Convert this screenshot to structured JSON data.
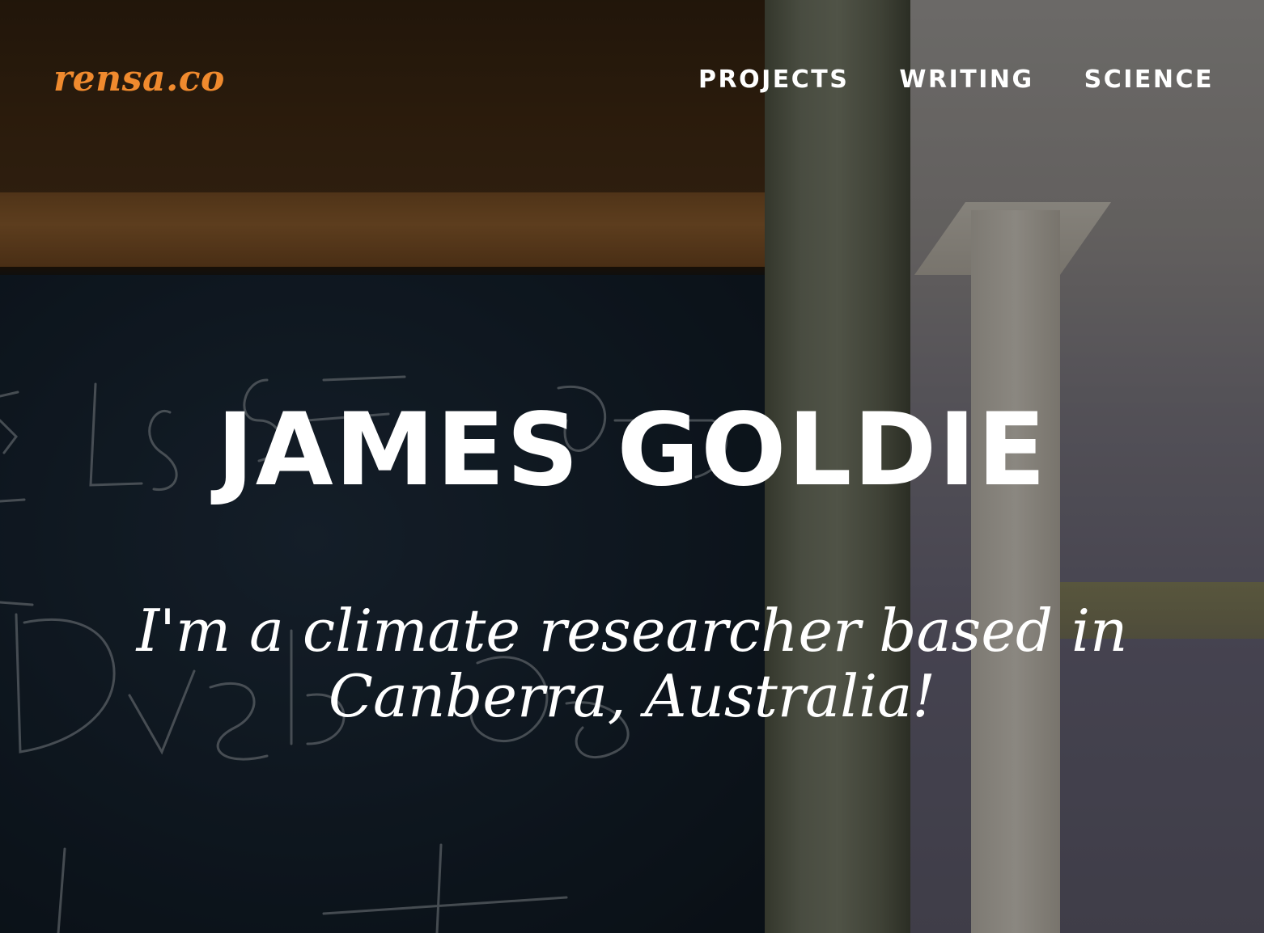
{
  "header": {
    "logo": "rensa.co",
    "nav": [
      {
        "label": "PROJECTS"
      },
      {
        "label": "WRITING"
      },
      {
        "label": "SCIENCE"
      }
    ]
  },
  "hero": {
    "title": "JAMES GOLDIE",
    "subtitle": "I'm a climate researcher based in Canberra, Australia!"
  },
  "colors": {
    "logo": "#f08a2e",
    "text": "#ffffff"
  }
}
